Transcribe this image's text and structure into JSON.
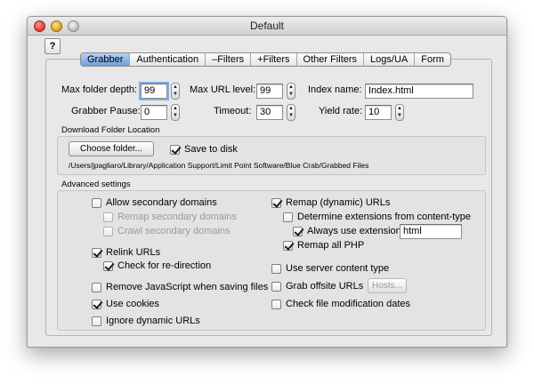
{
  "window": {
    "title": "Default"
  },
  "help_label": "?",
  "tabs": [
    {
      "label": "Grabber",
      "selected": true
    },
    {
      "label": "Authentication",
      "selected": false
    },
    {
      "label": "–Filters",
      "selected": false
    },
    {
      "label": "+Filters",
      "selected": false
    },
    {
      "label": "Other Filters",
      "selected": false
    },
    {
      "label": "Logs/UA",
      "selected": false
    },
    {
      "label": "Form",
      "selected": false
    }
  ],
  "fields": {
    "max_folder_depth": {
      "label": "Max folder depth:",
      "value": "99"
    },
    "max_url_level": {
      "label": "Max URL level:",
      "value": "99"
    },
    "index_name": {
      "label": "Index name:",
      "value": "Index.html"
    },
    "grabber_pause": {
      "label": "Grabber Pause:",
      "value": "0"
    },
    "timeout": {
      "label": "Timeout:",
      "value": "30"
    },
    "yield_rate": {
      "label": "Yield rate:",
      "value": "10"
    }
  },
  "download": {
    "title": "Download Folder Location",
    "choose_button": "Choose folder...",
    "save_to_disk": {
      "label": "Save to disk",
      "checked": true
    },
    "path": "/Users/jpagliaro/Library/Application Support/Limit Point Software/Blue Crab/Grabbed Files"
  },
  "advanced": {
    "title": "Advanced settings",
    "allow_secondary": {
      "label": "Allow secondary domains",
      "checked": false
    },
    "remap_secondary": {
      "label": "Remap secondary domains",
      "checked": false
    },
    "crawl_secondary": {
      "label": "Crawl secondary domains",
      "checked": false
    },
    "relink_urls": {
      "label": "Relink URLs",
      "checked": true
    },
    "check_redirection": {
      "label": "Check for re-direction",
      "checked": true
    },
    "remove_javascript": {
      "label": "Remove JavaScript when saving files",
      "checked": false
    },
    "use_cookies": {
      "label": "Use cookies",
      "checked": true
    },
    "ignore_dynamic": {
      "label": "Ignore dynamic URLs",
      "checked": false
    },
    "remap_dynamic": {
      "label": "Remap (dynamic) URLs",
      "checked": true
    },
    "determine_ext": {
      "label": "Determine extensions from content-type",
      "checked": false
    },
    "always_use_ext": {
      "label": "Always use extension:",
      "checked": true,
      "value": "html"
    },
    "remap_all_php": {
      "label": "Remap all PHP",
      "checked": true
    },
    "use_server_content_type": {
      "label": "Use server content type",
      "checked": false
    },
    "grab_offsite": {
      "label": "Grab offsite URLs",
      "checked": false
    },
    "hosts_button": "Hosts...",
    "check_mod_dates": {
      "label": "Check file modification dates",
      "checked": false
    }
  }
}
